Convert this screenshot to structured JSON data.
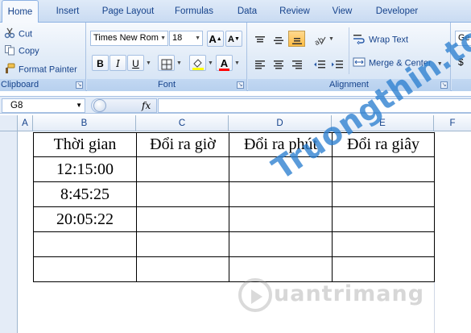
{
  "ribbon_tabs": [
    "Home",
    "Insert",
    "Page Layout",
    "Formulas",
    "Data",
    "Review",
    "View",
    "Developer"
  ],
  "clipboard": {
    "cut": "Cut",
    "copy": "Copy",
    "format_painter": "Format Painter",
    "label": "Clipboard"
  },
  "font": {
    "name": "Times New Rom",
    "size": "18",
    "bold": "B",
    "italic": "I",
    "underline": "U",
    "grow": "A",
    "shrink": "A",
    "font_color_letter": "A",
    "label": "Font",
    "highlight_color": "#ffff00",
    "font_color": "#ff0000"
  },
  "alignment": {
    "wrap_text": "Wrap Text",
    "merge_center": "Merge & Center",
    "label": "Alignment"
  },
  "number": {
    "format_partial": "Ge",
    "currency": "$"
  },
  "formula_bar": {
    "cell_ref": "G8",
    "fx": "fx",
    "formula": ""
  },
  "columns": [
    "A",
    "B",
    "C",
    "D",
    "E",
    "F"
  ],
  "table": {
    "headers": [
      "Thời gian",
      "Đổi ra giờ",
      "Đổi ra phút",
      "Đổi ra giây"
    ],
    "rows": [
      [
        "12:15:00",
        "",
        "",
        ""
      ],
      [
        "8:45:25",
        "",
        "",
        ""
      ],
      [
        "20:05:22",
        "",
        "",
        ""
      ],
      [
        "",
        "",
        "",
        ""
      ],
      [
        "",
        "",
        "",
        ""
      ]
    ]
  },
  "watermark": {
    "main": "Truongthin.top",
    "sub": "uantrimang"
  }
}
